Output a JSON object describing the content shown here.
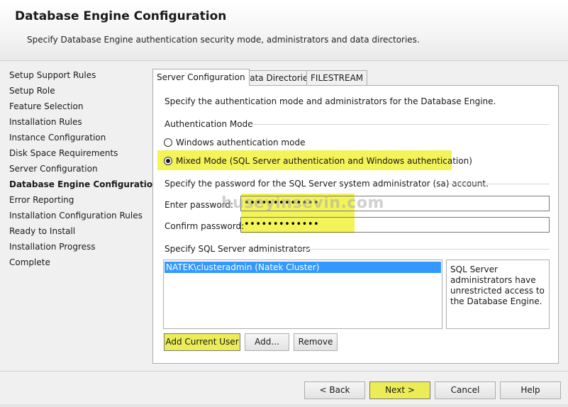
{
  "header": {
    "title": "Database Engine Configuration",
    "subtitle": "Specify Database Engine authentication security mode, administrators and data directories."
  },
  "nav": {
    "items": [
      "Setup Support Rules",
      "Setup Role",
      "Feature Selection",
      "Installation Rules",
      "Instance Configuration",
      "Disk Space Requirements",
      "Server Configuration",
      "Database Engine Configuration",
      "Error Reporting",
      "Installation Configuration Rules",
      "Ready to Install",
      "Installation Progress",
      "Complete"
    ],
    "active_index": 7
  },
  "tabs": [
    "Server Configuration",
    "Data Directories",
    "FILESTREAM"
  ],
  "panel": {
    "intro": "Specify the authentication mode and administrators for the Database Engine.",
    "auth_group": "Authentication Mode",
    "radio_windows": "Windows authentication mode",
    "radio_mixed": "Mixed Mode (SQL Server authentication and Windows authentication)",
    "sa_text": "Specify the password for the SQL Server system administrator (sa) account.",
    "enter_label": "Enter password:",
    "enter_value": "•••••••••••••",
    "confirm_label": "Confirm password:",
    "confirm_value": "•••••••••••••",
    "watermark": "huseyinsevin.com",
    "admins_group": "Specify SQL Server administrators",
    "admins": [
      "NATEK\\clusteradmin (Natek Cluster)"
    ],
    "admins_info": "SQL Server administrators have unrestricted access to the Database Engine.",
    "btn_add_current": "Add Current User",
    "btn_add": "Add...",
    "btn_remove": "Remove"
  },
  "footer": {
    "back": "< Back",
    "next": "Next >",
    "cancel": "Cancel",
    "help": "Help"
  },
  "colors": {
    "highlight": "#f3f35a",
    "selection": "#3399ff"
  }
}
